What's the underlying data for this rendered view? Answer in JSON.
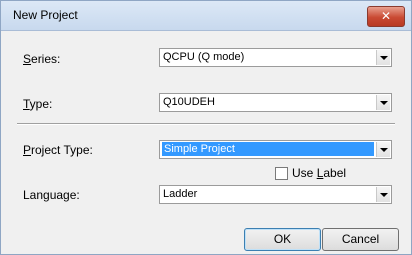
{
  "window": {
    "title": "New Project",
    "close_glyph": "✕"
  },
  "form": {
    "series": {
      "label_acc": "S",
      "label_rest": "eries:",
      "value": "QCPU (Q mode)"
    },
    "type": {
      "label_acc": "T",
      "label_rest": "ype:",
      "value": "Q10UDEH"
    },
    "project_type": {
      "label_acc": "P",
      "label_rest": "roject Type:",
      "value": "Simple Project"
    },
    "use_label": {
      "before": "Use ",
      "acc": "L",
      "after": "abel",
      "checked": false
    },
    "language": {
      "label_acc": "",
      "label_rest": "Language:",
      "value": "Ladder"
    }
  },
  "buttons": {
    "ok": "OK",
    "cancel": "Cancel"
  }
}
